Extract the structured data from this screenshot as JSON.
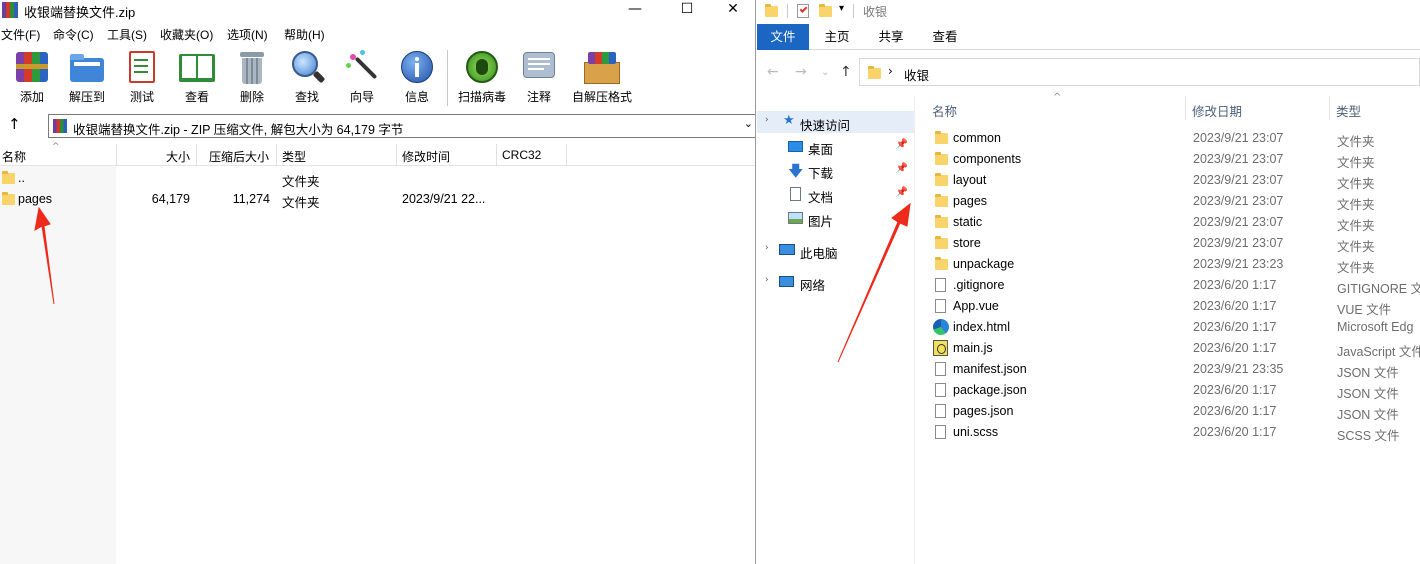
{
  "winrar": {
    "title": "收银端替换文件.zip",
    "window_controls": {
      "minimize": "—",
      "maximize": "☐",
      "close": "✕"
    },
    "menu": [
      "文件(F)",
      "命令(C)",
      "工具(S)",
      "收藏夹(O)",
      "选项(N)",
      "帮助(H)"
    ],
    "toolbar": [
      {
        "label": "添加",
        "icon": "add-archive-icon"
      },
      {
        "label": "解压到",
        "icon": "extract-to-icon"
      },
      {
        "label": "测试",
        "icon": "test-icon"
      },
      {
        "label": "查看",
        "icon": "view-icon"
      },
      {
        "label": "删除",
        "icon": "delete-icon"
      },
      {
        "label": "查找",
        "icon": "find-icon"
      },
      {
        "label": "向导",
        "icon": "wizard-icon"
      },
      {
        "label": "信息",
        "icon": "info-icon"
      },
      {
        "label": "扫描病毒",
        "icon": "virus-scan-icon"
      },
      {
        "label": "注释",
        "icon": "comment-icon"
      },
      {
        "label": "自解压格式",
        "icon": "sfx-icon"
      }
    ],
    "address": "收银端替换文件.zip - ZIP 压缩文件, 解包大小为 64,179 字节",
    "columns": [
      "名称",
      "大小",
      "压缩后大小",
      "类型",
      "修改时间",
      "CRC32"
    ],
    "rows": [
      {
        "name": "..",
        "size": "",
        "packed": "",
        "type": "文件夹",
        "modified": ""
      },
      {
        "name": "pages",
        "size": "64,179",
        "packed": "11,274",
        "type": "文件夹",
        "modified": "2023/9/21 22..."
      }
    ]
  },
  "explorer": {
    "title": "收银",
    "ribbon_tabs": [
      "文件",
      "主页",
      "共享",
      "查看"
    ],
    "breadcrumb": "收银",
    "nav": {
      "quick_access": "快速访问",
      "items": [
        "桌面",
        "下载",
        "文档",
        "图片"
      ],
      "this_pc": "此电脑",
      "network": "网络"
    },
    "columns": [
      "名称",
      "修改日期",
      "类型"
    ],
    "files": [
      {
        "name": "common",
        "date": "2023/9/21 23:07",
        "type": "文件夹",
        "kind": "folder"
      },
      {
        "name": "components",
        "date": "2023/9/21 23:07",
        "type": "文件夹",
        "kind": "folder"
      },
      {
        "name": "layout",
        "date": "2023/9/21 23:07",
        "type": "文件夹",
        "kind": "folder"
      },
      {
        "name": "pages",
        "date": "2023/9/21 23:07",
        "type": "文件夹",
        "kind": "folder"
      },
      {
        "name": "static",
        "date": "2023/9/21 23:07",
        "type": "文件夹",
        "kind": "folder"
      },
      {
        "name": "store",
        "date": "2023/9/21 23:07",
        "type": "文件夹",
        "kind": "folder"
      },
      {
        "name": "unpackage",
        "date": "2023/9/21 23:23",
        "type": "文件夹",
        "kind": "folder"
      },
      {
        "name": ".gitignore",
        "date": "2023/6/20 1:17",
        "type": "GITIGNORE 文",
        "kind": "file"
      },
      {
        "name": "App.vue",
        "date": "2023/6/20 1:17",
        "type": "VUE 文件",
        "kind": "file"
      },
      {
        "name": "index.html",
        "date": "2023/6/20 1:17",
        "type": "Microsoft Edg",
        "kind": "edge"
      },
      {
        "name": "main.js",
        "date": "2023/6/20 1:17",
        "type": "JavaScript 文件",
        "kind": "js"
      },
      {
        "name": "manifest.json",
        "date": "2023/9/21 23:35",
        "type": "JSON 文件",
        "kind": "file"
      },
      {
        "name": "package.json",
        "date": "2023/6/20 1:17",
        "type": "JSON 文件",
        "kind": "file"
      },
      {
        "name": "pages.json",
        "date": "2023/6/20 1:17",
        "type": "JSON 文件",
        "kind": "file"
      },
      {
        "name": "uni.scss",
        "date": "2023/6/20 1:17",
        "type": "SCSS 文件",
        "kind": "file"
      }
    ]
  },
  "annotation_color": "#ee2a1b"
}
